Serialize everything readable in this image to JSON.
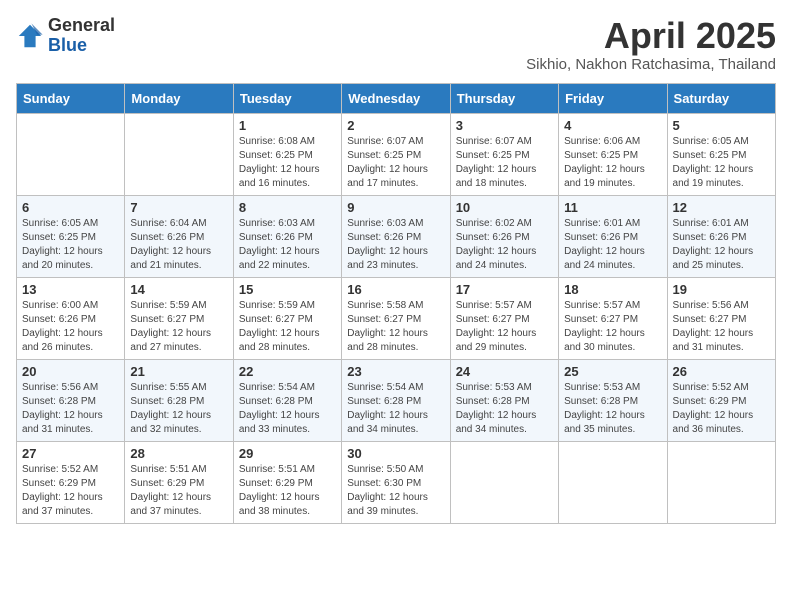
{
  "header": {
    "logo_general": "General",
    "logo_blue": "Blue",
    "title": "April 2025",
    "subtitle": "Sikhio, Nakhon Ratchasima, Thailand"
  },
  "weekdays": [
    "Sunday",
    "Monday",
    "Tuesday",
    "Wednesday",
    "Thursday",
    "Friday",
    "Saturday"
  ],
  "weeks": [
    [
      {
        "day": "",
        "info": ""
      },
      {
        "day": "",
        "info": ""
      },
      {
        "day": "1",
        "info": "Sunrise: 6:08 AM\nSunset: 6:25 PM\nDaylight: 12 hours and 16 minutes."
      },
      {
        "day": "2",
        "info": "Sunrise: 6:07 AM\nSunset: 6:25 PM\nDaylight: 12 hours and 17 minutes."
      },
      {
        "day": "3",
        "info": "Sunrise: 6:07 AM\nSunset: 6:25 PM\nDaylight: 12 hours and 18 minutes."
      },
      {
        "day": "4",
        "info": "Sunrise: 6:06 AM\nSunset: 6:25 PM\nDaylight: 12 hours and 19 minutes."
      },
      {
        "day": "5",
        "info": "Sunrise: 6:05 AM\nSunset: 6:25 PM\nDaylight: 12 hours and 19 minutes."
      }
    ],
    [
      {
        "day": "6",
        "info": "Sunrise: 6:05 AM\nSunset: 6:25 PM\nDaylight: 12 hours and 20 minutes."
      },
      {
        "day": "7",
        "info": "Sunrise: 6:04 AM\nSunset: 6:26 PM\nDaylight: 12 hours and 21 minutes."
      },
      {
        "day": "8",
        "info": "Sunrise: 6:03 AM\nSunset: 6:26 PM\nDaylight: 12 hours and 22 minutes."
      },
      {
        "day": "9",
        "info": "Sunrise: 6:03 AM\nSunset: 6:26 PM\nDaylight: 12 hours and 23 minutes."
      },
      {
        "day": "10",
        "info": "Sunrise: 6:02 AM\nSunset: 6:26 PM\nDaylight: 12 hours and 24 minutes."
      },
      {
        "day": "11",
        "info": "Sunrise: 6:01 AM\nSunset: 6:26 PM\nDaylight: 12 hours and 24 minutes."
      },
      {
        "day": "12",
        "info": "Sunrise: 6:01 AM\nSunset: 6:26 PM\nDaylight: 12 hours and 25 minutes."
      }
    ],
    [
      {
        "day": "13",
        "info": "Sunrise: 6:00 AM\nSunset: 6:26 PM\nDaylight: 12 hours and 26 minutes."
      },
      {
        "day": "14",
        "info": "Sunrise: 5:59 AM\nSunset: 6:27 PM\nDaylight: 12 hours and 27 minutes."
      },
      {
        "day": "15",
        "info": "Sunrise: 5:59 AM\nSunset: 6:27 PM\nDaylight: 12 hours and 28 minutes."
      },
      {
        "day": "16",
        "info": "Sunrise: 5:58 AM\nSunset: 6:27 PM\nDaylight: 12 hours and 28 minutes."
      },
      {
        "day": "17",
        "info": "Sunrise: 5:57 AM\nSunset: 6:27 PM\nDaylight: 12 hours and 29 minutes."
      },
      {
        "day": "18",
        "info": "Sunrise: 5:57 AM\nSunset: 6:27 PM\nDaylight: 12 hours and 30 minutes."
      },
      {
        "day": "19",
        "info": "Sunrise: 5:56 AM\nSunset: 6:27 PM\nDaylight: 12 hours and 31 minutes."
      }
    ],
    [
      {
        "day": "20",
        "info": "Sunrise: 5:56 AM\nSunset: 6:28 PM\nDaylight: 12 hours and 31 minutes."
      },
      {
        "day": "21",
        "info": "Sunrise: 5:55 AM\nSunset: 6:28 PM\nDaylight: 12 hours and 32 minutes."
      },
      {
        "day": "22",
        "info": "Sunrise: 5:54 AM\nSunset: 6:28 PM\nDaylight: 12 hours and 33 minutes."
      },
      {
        "day": "23",
        "info": "Sunrise: 5:54 AM\nSunset: 6:28 PM\nDaylight: 12 hours and 34 minutes."
      },
      {
        "day": "24",
        "info": "Sunrise: 5:53 AM\nSunset: 6:28 PM\nDaylight: 12 hours and 34 minutes."
      },
      {
        "day": "25",
        "info": "Sunrise: 5:53 AM\nSunset: 6:28 PM\nDaylight: 12 hours and 35 minutes."
      },
      {
        "day": "26",
        "info": "Sunrise: 5:52 AM\nSunset: 6:29 PM\nDaylight: 12 hours and 36 minutes."
      }
    ],
    [
      {
        "day": "27",
        "info": "Sunrise: 5:52 AM\nSunset: 6:29 PM\nDaylight: 12 hours and 37 minutes."
      },
      {
        "day": "28",
        "info": "Sunrise: 5:51 AM\nSunset: 6:29 PM\nDaylight: 12 hours and 37 minutes."
      },
      {
        "day": "29",
        "info": "Sunrise: 5:51 AM\nSunset: 6:29 PM\nDaylight: 12 hours and 38 minutes."
      },
      {
        "day": "30",
        "info": "Sunrise: 5:50 AM\nSunset: 6:30 PM\nDaylight: 12 hours and 39 minutes."
      },
      {
        "day": "",
        "info": ""
      },
      {
        "day": "",
        "info": ""
      },
      {
        "day": "",
        "info": ""
      }
    ]
  ]
}
